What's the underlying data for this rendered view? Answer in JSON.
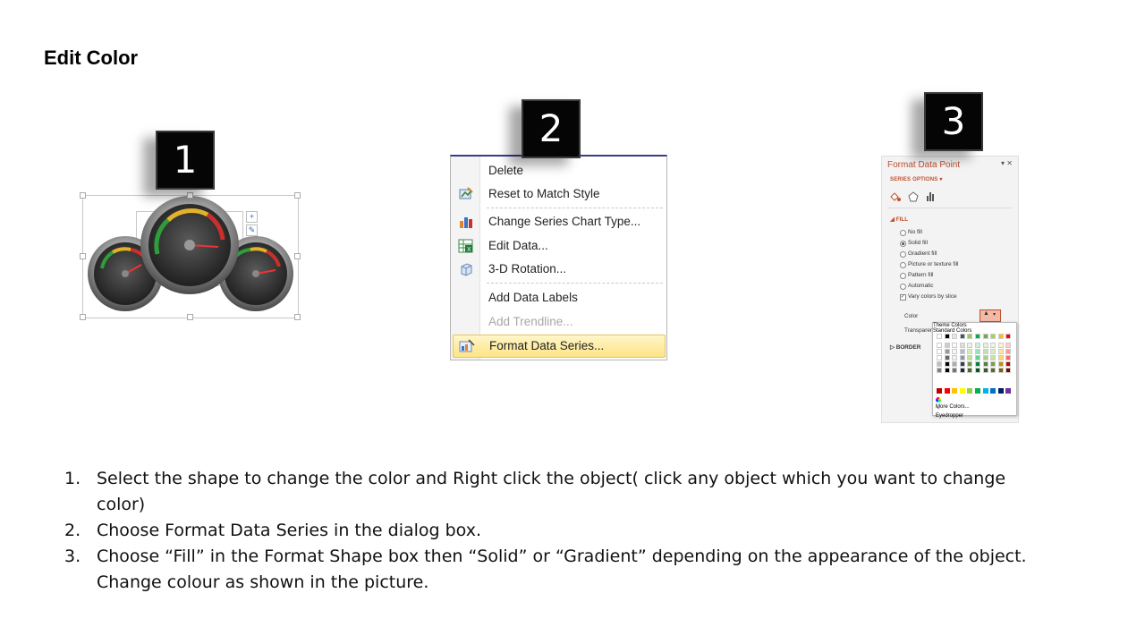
{
  "slide": {
    "title": "Edit Color"
  },
  "steps": [
    "1",
    "2",
    "3"
  ],
  "context_menu": {
    "items": [
      {
        "label": "Delete",
        "icon": "none",
        "disabled": false,
        "highlighted": false
      },
      {
        "label": "Reset to Match Style",
        "icon": "reset-style-icon",
        "disabled": false,
        "highlighted": false
      },
      {
        "label": "Change Series Chart Type...",
        "icon": "chart-type-icon",
        "disabled": false,
        "highlighted": false
      },
      {
        "label": "Edit Data...",
        "icon": "excel-grid-icon",
        "disabled": false,
        "highlighted": false
      },
      {
        "label": "3-D Rotation...",
        "icon": "cube-icon",
        "disabled": false,
        "highlighted": false
      },
      {
        "label": "Add Data Labels",
        "icon": "none",
        "disabled": false,
        "highlighted": false
      },
      {
        "label": "Add Trendline...",
        "icon": "none",
        "disabled": true,
        "highlighted": false
      },
      {
        "label": "Format Data Series...",
        "icon": "format-series-icon",
        "disabled": false,
        "highlighted": true
      }
    ]
  },
  "format_pane": {
    "title": "Format Data Point",
    "close": "▾ ✕",
    "series_options": "SERIES OPTIONS ▾",
    "section_fill": "FILL",
    "fill_options": [
      "No fill",
      "Solid fill",
      "Gradient fill",
      "Picture or texture fill",
      "Pattern fill",
      "Automatic"
    ],
    "selected_fill": "Solid fill",
    "vary_colors": "Vary colors by slice",
    "color_label": "Color",
    "transparency_label": "Transparenc",
    "section_border": "BORDER",
    "theme_colors_label": "Theme Colors",
    "standard_colors_label": "Standard Colors",
    "more_colors": "More Colors...",
    "eyedropper": "Eyedropper",
    "accent_color": "#c0502d",
    "standard_colors": [
      "#c00000",
      "#ff0000",
      "#ffc000",
      "#ffff00",
      "#92d050",
      "#00b050",
      "#00b0f0",
      "#0070c0",
      "#002060",
      "#7030a0"
    ],
    "theme_columns": [
      "#ffffff",
      "#000000",
      "#e7e6e6",
      "#44546a",
      "#92d050",
      "#00b050",
      "#70ad47",
      "#a5d35b",
      "#ffc000",
      "#ff0000"
    ]
  },
  "instructions": [
    {
      "num": "1.",
      "text": "Select the shape to change the color and Right click the object( click any object which you want to change color)"
    },
    {
      "num": "2.",
      "text": "Choose Format Data Series in the dialog box."
    },
    {
      "num": "3.",
      "text": "Choose “Fill” in the Format Shape box then “Solid” or “Gradient” depending on the appearance of the object. Change colour as shown in the picture."
    }
  ]
}
